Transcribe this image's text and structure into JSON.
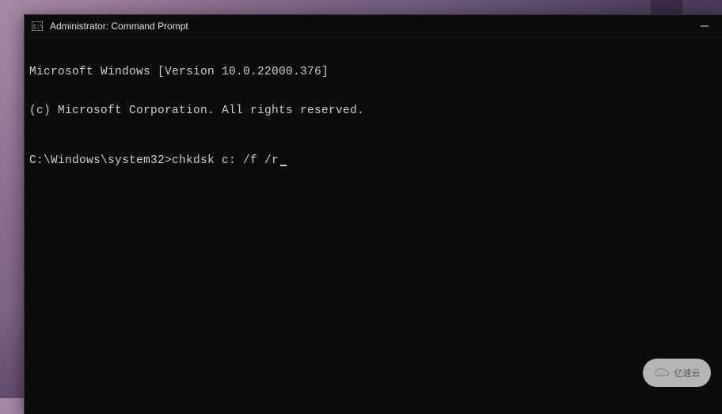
{
  "window": {
    "title": "Administrator: Command Prompt"
  },
  "terminal": {
    "line1": "Microsoft Windows [Version 10.0.22000.376]",
    "line2": "(c) Microsoft Corporation. All rights reserved.",
    "prompt": "C:\\Windows\\system32>",
    "command": "chkdsk c: /f /r"
  },
  "watermark": {
    "text": "亿速云"
  }
}
